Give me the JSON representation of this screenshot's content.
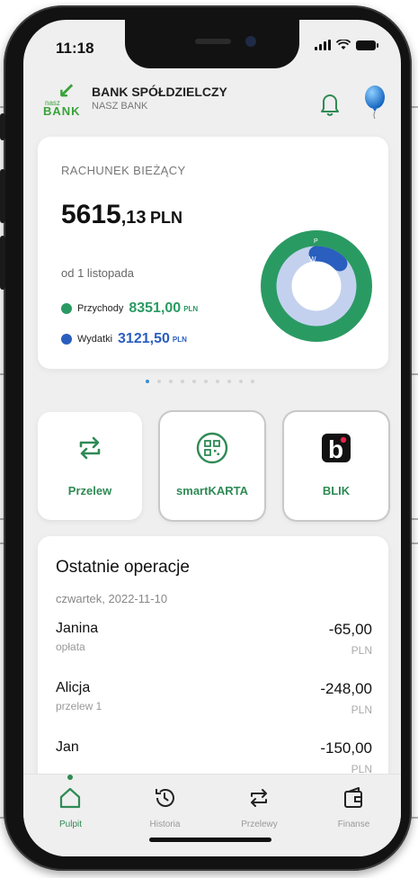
{
  "status_bar": {
    "time": "11:18"
  },
  "header": {
    "logo_small": "nasz",
    "logo_big": "BANK",
    "bank_name": "BANK SPÓŁDZIELCZY",
    "bank_sub": "NASZ BANK"
  },
  "account": {
    "label": "RACHUNEK BIEŻĄCY",
    "balance_int": "5615",
    "balance_dec": ",13",
    "balance_cur": "PLN",
    "period": "od 1 listopada",
    "income": {
      "label": "Przychody",
      "value": "8351,00",
      "currency": "PLN",
      "color": "#2a9a63"
    },
    "expenses": {
      "label": "Wydatki",
      "value": "3121,50",
      "currency": "PLN",
      "color": "#2a5ebf"
    },
    "donut_marks": {
      "income_mark": "P",
      "expense_mark": "W"
    }
  },
  "pager": {
    "count": 10,
    "active": 0
  },
  "tiles": [
    {
      "label": "Przelew",
      "icon": "transfer-icon"
    },
    {
      "label": "smartKARTA",
      "icon": "qr-code-icon"
    },
    {
      "label": "BLIK",
      "icon": "blik-icon",
      "icon_letter": "b"
    }
  ],
  "recent": {
    "title": "Ostatnie operacje",
    "date": "czwartek, 2022-11-10",
    "items": [
      {
        "name": "Janina",
        "desc": "opłata",
        "amount": "-65,00",
        "currency": "PLN"
      },
      {
        "name": "Alicja",
        "desc": "przelew 1",
        "amount": "-248,00",
        "currency": "PLN"
      },
      {
        "name": "Jan",
        "desc": "",
        "amount": "-150,00",
        "currency": "PLN"
      }
    ]
  },
  "bottom_nav": [
    {
      "label": "Pulpit",
      "icon": "home-icon",
      "active": true
    },
    {
      "label": "Historia",
      "icon": "history-icon",
      "active": false
    },
    {
      "label": "Przelewy",
      "icon": "transfers-icon",
      "active": false
    },
    {
      "label": "Finanse",
      "icon": "wallet-icon",
      "active": false
    }
  ],
  "colors": {
    "accent_green": "#2f8a55",
    "blue": "#2a5ebf"
  }
}
